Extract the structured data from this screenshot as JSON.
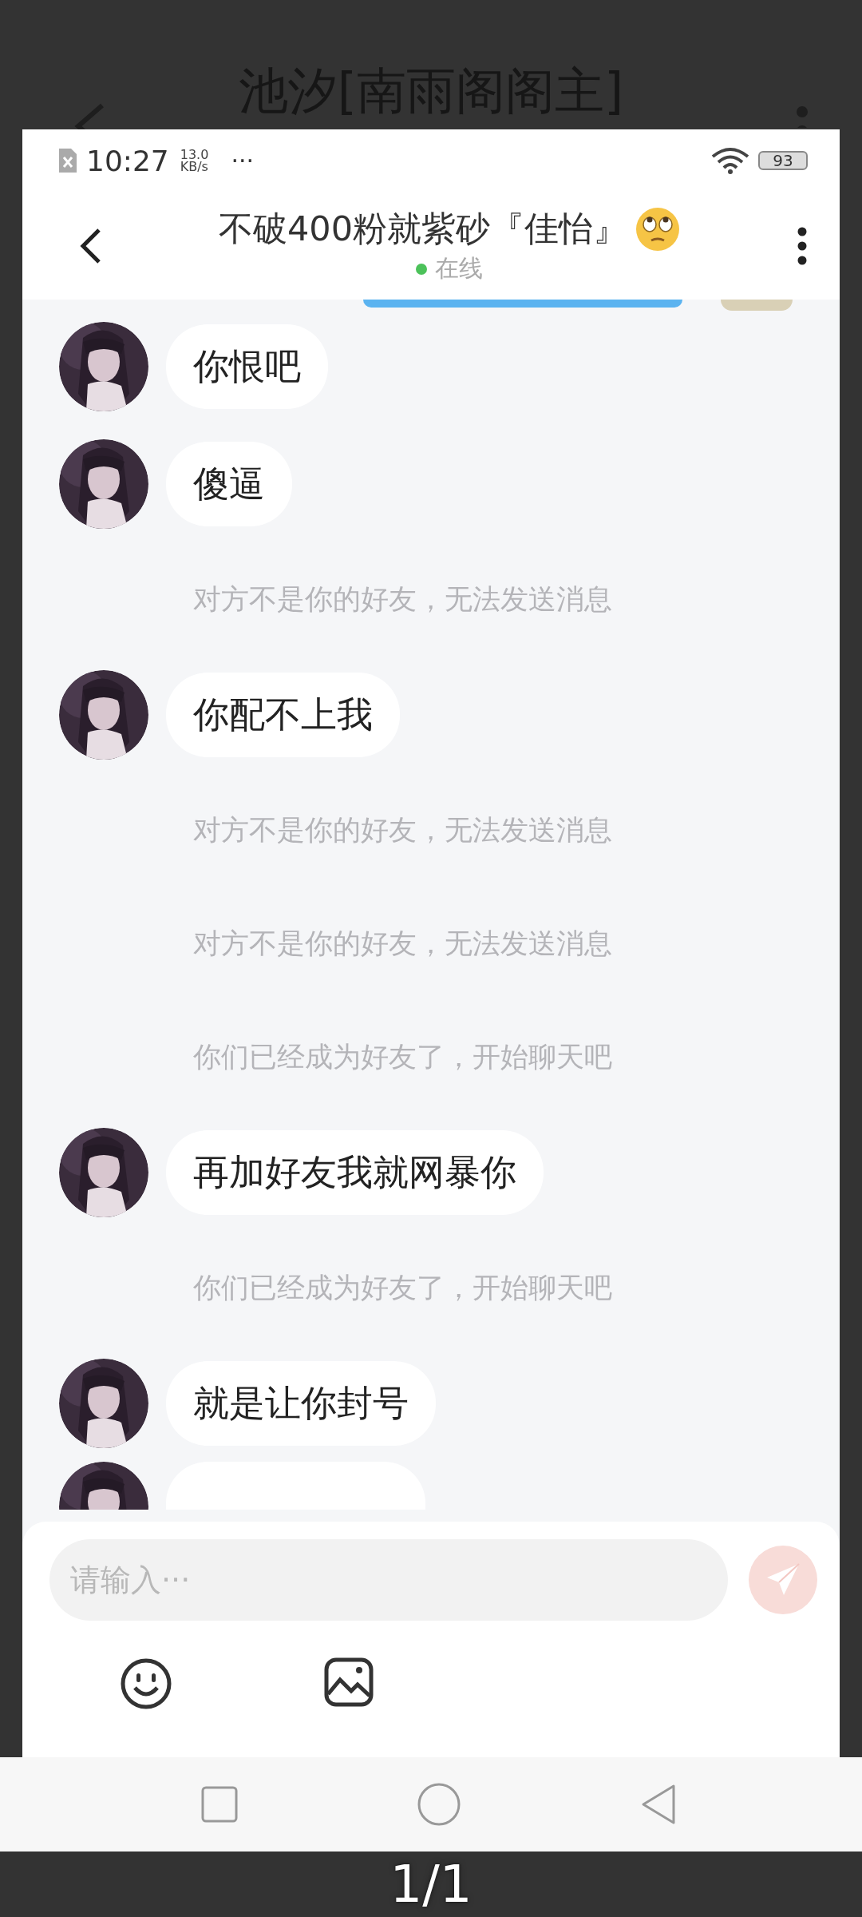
{
  "viewer": {
    "title": "池汐[南雨阁阁主]",
    "page_indicator": "1/1"
  },
  "status_bar": {
    "time": "10:27",
    "net_speed": "13.0",
    "net_unit": "KB/s",
    "more": "···",
    "battery": "93"
  },
  "header": {
    "title": "不破400粉就紫砂『佳怡』",
    "status": "在线",
    "online": true
  },
  "messages": [
    {
      "kind": "sent_cut"
    },
    {
      "kind": "received",
      "text": "你恨吧"
    },
    {
      "kind": "received",
      "text": "傻逼"
    },
    {
      "kind": "notice",
      "text": "对方不是你的好友，无法发送消息"
    },
    {
      "kind": "received",
      "text": "你配不上我"
    },
    {
      "kind": "notice",
      "text": "对方不是你的好友，无法发送消息"
    },
    {
      "kind": "notice",
      "text": "对方不是你的好友，无法发送消息"
    },
    {
      "kind": "notice",
      "text": "你们已经成为好友了，开始聊天吧"
    },
    {
      "kind": "received",
      "text": "再加好友我就网暴你"
    },
    {
      "kind": "notice",
      "text": "你们已经成为好友了，开始聊天吧"
    },
    {
      "kind": "received",
      "text": "就是让你封号"
    },
    {
      "kind": "received_cut"
    }
  ],
  "input": {
    "placeholder": "请输入···"
  }
}
